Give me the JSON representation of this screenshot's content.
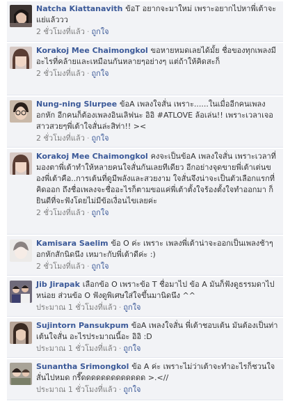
{
  "comments": [
    {
      "author": "Natcha Kiattanavith",
      "text": "ข้อT อยากจะมาใหม่ เพราะอยากไปหาพี่เต้าจะแย่แล้ววว",
      "time": "2 ชั่วโมงที่แล้ว",
      "like": "ถูกใจ"
    },
    {
      "author": "Korakoj Mee Chaimongkol",
      "text": "ขอหายหมดเลยได้มั้ย ชื่อของทุกเพลงมีอะไรที่คล้ายและเหมือนกันหลายๆอย่างๆ แต่ถ้าให้คิดสะก็",
      "time": "2 ชั่วโมงที่แล้ว",
      "like": "ถูกใจ"
    },
    {
      "author": "Nung-ning Slurpee",
      "text": "ข้อA เพลงใจสั่น เพราะ......ในเมื่ออีกคนเพลงอกหัก อีกคนก็ต้องเพลงอินเลิฟนะ อิอิ #ATLOVE ล้อเล่น!! เพราะเวลาเจอสาวสวยๆพี่เต้าใจสั่นล่ะสิท่า!! ><",
      "time": "2 ชั่วโมงที่แล้ว",
      "like": "ถูกใจ"
    },
    {
      "author": "Korakoj Mee Chaimongkol",
      "text": "คงจะเป็นข้อA เพลงใจสั่น เพราะเวลาที่มองตาพี่เต้าทำให้หลายคนใจสั่นกันเลยทีเดียว อีกอย่างจุดขายพี่เต้าเต่นของพี่เต้าคือ..การเต้นที่ดูมีพลังและสวยงาม ใจสั่นจึงน่าจะเป็นตัวเลือกแรกที่คิดออก ถึงชื่อเพลงจะชื่ออะไรก็ตามขอแค่พี่เต้าตั้งใจร้องตั้งใจทำออกมา ก็ยินดีที่จะฟังโดยไม่มีข้อเงื่อนไขเลยค่ะ",
      "time": "2 ชั่วโมงที่แล้ว",
      "like": "ถูกใจ"
    },
    {
      "author": "Kamisara Saelim",
      "text": "ข้อ O ค่ะ เพราะ เพลงพี่เต้าน่าจะออกเป็นเพลงช้าๆ อกหักสักนิดนึง เหมาะกับพี่เต้าดีค่ะ :)",
      "time": "2 ชั่วโมงที่แล้ว",
      "like": "ถูกใจ"
    },
    {
      "author": "Jib Jirapak",
      "text": "เลือกข้อ O เพราะข้อ T ชื่อมาไป ข้อ A มันก็ฟังดูธรรมดาไปหน่อย ส่วนข้อ O ฟังดูพิเศษใส่ใจขึ้นมานิดนึง ^^",
      "time": "ประมาณ 1 ชั่วโมงที่แล้ว",
      "like": "ถูกใจ"
    },
    {
      "author": "Sujintorn Pansukpum",
      "text": "ข้อA เพลงใจสั่น พี่เต้าชอบเต้น มันต้องเป็นท่าเต้นใจสั่น อะไรประมาณนี้อะ อิอิ :D",
      "time": "ประมาณ 1 ชั่วโมงที่แล้ว",
      "like": "ถูกใจ"
    },
    {
      "author": "Sunantha Srimongkol",
      "text": "ข้อ A ค่ะ เพราะไม่ว่าเต้าจะทำอะไรก็ชวนใจสั่นไปหมด กรี๊ดดดดดดดดดดดดด >.<//",
      "time": "ประมาณ 1 ชั่วโมงที่แล้ว",
      "like": "ถูกใจ"
    }
  ],
  "avatar_icons": [
    "girl-selfie-icon",
    "girl-bangs-icon",
    "girl-glasses-icon",
    "girl-bangs-icon",
    "girl-pale-icon",
    "group-photo-icon",
    "girl-long-hair-icon",
    "girl-group-icon"
  ],
  "colors": {
    "link": "#3b5998",
    "panel": "#f2f3f6",
    "meta": "#7f7f7f"
  }
}
